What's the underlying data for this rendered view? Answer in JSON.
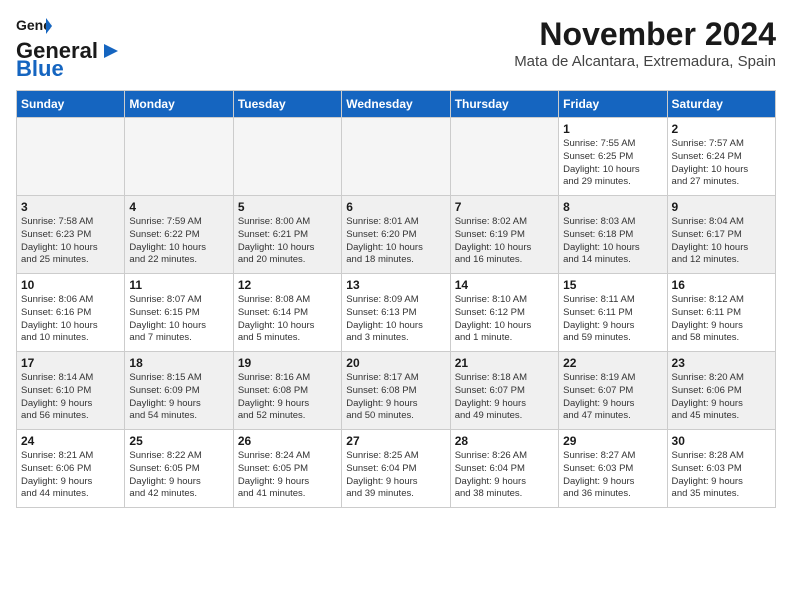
{
  "header": {
    "logo_general": "General",
    "logo_blue": "Blue",
    "month": "November 2024",
    "location": "Mata de Alcantara, Extremadura, Spain"
  },
  "days_of_week": [
    "Sunday",
    "Monday",
    "Tuesday",
    "Wednesday",
    "Thursday",
    "Friday",
    "Saturday"
  ],
  "weeks": [
    [
      {
        "day": "",
        "empty": true
      },
      {
        "day": "",
        "empty": true
      },
      {
        "day": "",
        "empty": true
      },
      {
        "day": "",
        "empty": true
      },
      {
        "day": "",
        "empty": true
      },
      {
        "day": "1",
        "lines": [
          "Sunrise: 7:55 AM",
          "Sunset: 6:25 PM",
          "Daylight: 10 hours",
          "and 29 minutes."
        ]
      },
      {
        "day": "2",
        "lines": [
          "Sunrise: 7:57 AM",
          "Sunset: 6:24 PM",
          "Daylight: 10 hours",
          "and 27 minutes."
        ]
      }
    ],
    [
      {
        "day": "3",
        "lines": [
          "Sunrise: 7:58 AM",
          "Sunset: 6:23 PM",
          "Daylight: 10 hours",
          "and 25 minutes."
        ]
      },
      {
        "day": "4",
        "lines": [
          "Sunrise: 7:59 AM",
          "Sunset: 6:22 PM",
          "Daylight: 10 hours",
          "and 22 minutes."
        ]
      },
      {
        "day": "5",
        "lines": [
          "Sunrise: 8:00 AM",
          "Sunset: 6:21 PM",
          "Daylight: 10 hours",
          "and 20 minutes."
        ]
      },
      {
        "day": "6",
        "lines": [
          "Sunrise: 8:01 AM",
          "Sunset: 6:20 PM",
          "Daylight: 10 hours",
          "and 18 minutes."
        ]
      },
      {
        "day": "7",
        "lines": [
          "Sunrise: 8:02 AM",
          "Sunset: 6:19 PM",
          "Daylight: 10 hours",
          "and 16 minutes."
        ]
      },
      {
        "day": "8",
        "lines": [
          "Sunrise: 8:03 AM",
          "Sunset: 6:18 PM",
          "Daylight: 10 hours",
          "and 14 minutes."
        ]
      },
      {
        "day": "9",
        "lines": [
          "Sunrise: 8:04 AM",
          "Sunset: 6:17 PM",
          "Daylight: 10 hours",
          "and 12 minutes."
        ]
      }
    ],
    [
      {
        "day": "10",
        "lines": [
          "Sunrise: 8:06 AM",
          "Sunset: 6:16 PM",
          "Daylight: 10 hours",
          "and 10 minutes."
        ]
      },
      {
        "day": "11",
        "lines": [
          "Sunrise: 8:07 AM",
          "Sunset: 6:15 PM",
          "Daylight: 10 hours",
          "and 7 minutes."
        ]
      },
      {
        "day": "12",
        "lines": [
          "Sunrise: 8:08 AM",
          "Sunset: 6:14 PM",
          "Daylight: 10 hours",
          "and 5 minutes."
        ]
      },
      {
        "day": "13",
        "lines": [
          "Sunrise: 8:09 AM",
          "Sunset: 6:13 PM",
          "Daylight: 10 hours",
          "and 3 minutes."
        ]
      },
      {
        "day": "14",
        "lines": [
          "Sunrise: 8:10 AM",
          "Sunset: 6:12 PM",
          "Daylight: 10 hours",
          "and 1 minute."
        ]
      },
      {
        "day": "15",
        "lines": [
          "Sunrise: 8:11 AM",
          "Sunset: 6:11 PM",
          "Daylight: 9 hours",
          "and 59 minutes."
        ]
      },
      {
        "day": "16",
        "lines": [
          "Sunrise: 8:12 AM",
          "Sunset: 6:11 PM",
          "Daylight: 9 hours",
          "and 58 minutes."
        ]
      }
    ],
    [
      {
        "day": "17",
        "lines": [
          "Sunrise: 8:14 AM",
          "Sunset: 6:10 PM",
          "Daylight: 9 hours",
          "and 56 minutes."
        ]
      },
      {
        "day": "18",
        "lines": [
          "Sunrise: 8:15 AM",
          "Sunset: 6:09 PM",
          "Daylight: 9 hours",
          "and 54 minutes."
        ]
      },
      {
        "day": "19",
        "lines": [
          "Sunrise: 8:16 AM",
          "Sunset: 6:08 PM",
          "Daylight: 9 hours",
          "and 52 minutes."
        ]
      },
      {
        "day": "20",
        "lines": [
          "Sunrise: 8:17 AM",
          "Sunset: 6:08 PM",
          "Daylight: 9 hours",
          "and 50 minutes."
        ]
      },
      {
        "day": "21",
        "lines": [
          "Sunrise: 8:18 AM",
          "Sunset: 6:07 PM",
          "Daylight: 9 hours",
          "and 49 minutes."
        ]
      },
      {
        "day": "22",
        "lines": [
          "Sunrise: 8:19 AM",
          "Sunset: 6:07 PM",
          "Daylight: 9 hours",
          "and 47 minutes."
        ]
      },
      {
        "day": "23",
        "lines": [
          "Sunrise: 8:20 AM",
          "Sunset: 6:06 PM",
          "Daylight: 9 hours",
          "and 45 minutes."
        ]
      }
    ],
    [
      {
        "day": "24",
        "lines": [
          "Sunrise: 8:21 AM",
          "Sunset: 6:06 PM",
          "Daylight: 9 hours",
          "and 44 minutes."
        ]
      },
      {
        "day": "25",
        "lines": [
          "Sunrise: 8:22 AM",
          "Sunset: 6:05 PM",
          "Daylight: 9 hours",
          "and 42 minutes."
        ]
      },
      {
        "day": "26",
        "lines": [
          "Sunrise: 8:24 AM",
          "Sunset: 6:05 PM",
          "Daylight: 9 hours",
          "and 41 minutes."
        ]
      },
      {
        "day": "27",
        "lines": [
          "Sunrise: 8:25 AM",
          "Sunset: 6:04 PM",
          "Daylight: 9 hours",
          "and 39 minutes."
        ]
      },
      {
        "day": "28",
        "lines": [
          "Sunrise: 8:26 AM",
          "Sunset: 6:04 PM",
          "Daylight: 9 hours",
          "and 38 minutes."
        ]
      },
      {
        "day": "29",
        "lines": [
          "Sunrise: 8:27 AM",
          "Sunset: 6:03 PM",
          "Daylight: 9 hours",
          "and 36 minutes."
        ]
      },
      {
        "day": "30",
        "lines": [
          "Sunrise: 8:28 AM",
          "Sunset: 6:03 PM",
          "Daylight: 9 hours",
          "and 35 minutes."
        ]
      }
    ]
  ]
}
